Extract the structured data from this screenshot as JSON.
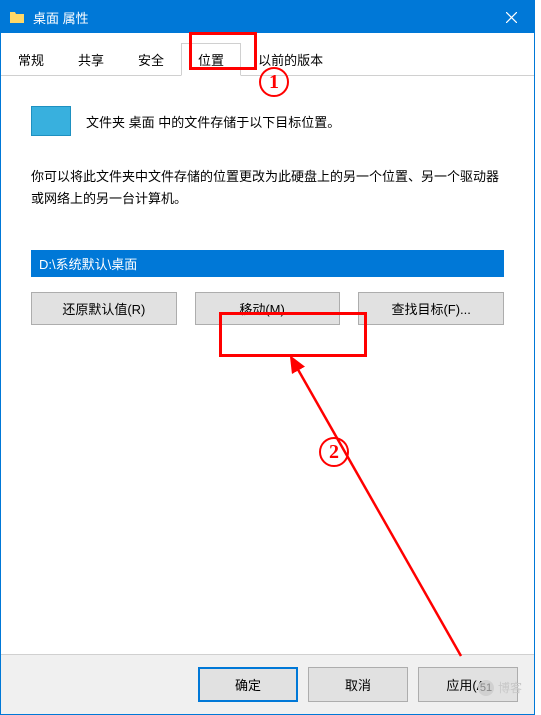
{
  "titlebar": {
    "title": "桌面 属性"
  },
  "tabs": {
    "items": [
      {
        "label": "常规"
      },
      {
        "label": "共享"
      },
      {
        "label": "安全"
      },
      {
        "label": "位置"
      },
      {
        "label": "以前的版本"
      }
    ]
  },
  "content": {
    "folder_line": "文件夹 桌面 中的文件存储于以下目标位置。",
    "desc": "你可以将此文件夹中文件存储的位置更改为此硬盘上的另一个位置、另一个驱动器或网络上的另一台计算机。",
    "path_value": "D:\\系统默认\\桌面",
    "btn_restore": "还原默认值(R)",
    "btn_move": "移动(M)...",
    "btn_find": "查找目标(F)..."
  },
  "bottom": {
    "ok": "确定",
    "cancel": "取消",
    "apply": "应用(A)"
  },
  "annotations": {
    "num1": "1",
    "num2": "2"
  },
  "watermark": {
    "text": "博客",
    "badge": "51"
  }
}
